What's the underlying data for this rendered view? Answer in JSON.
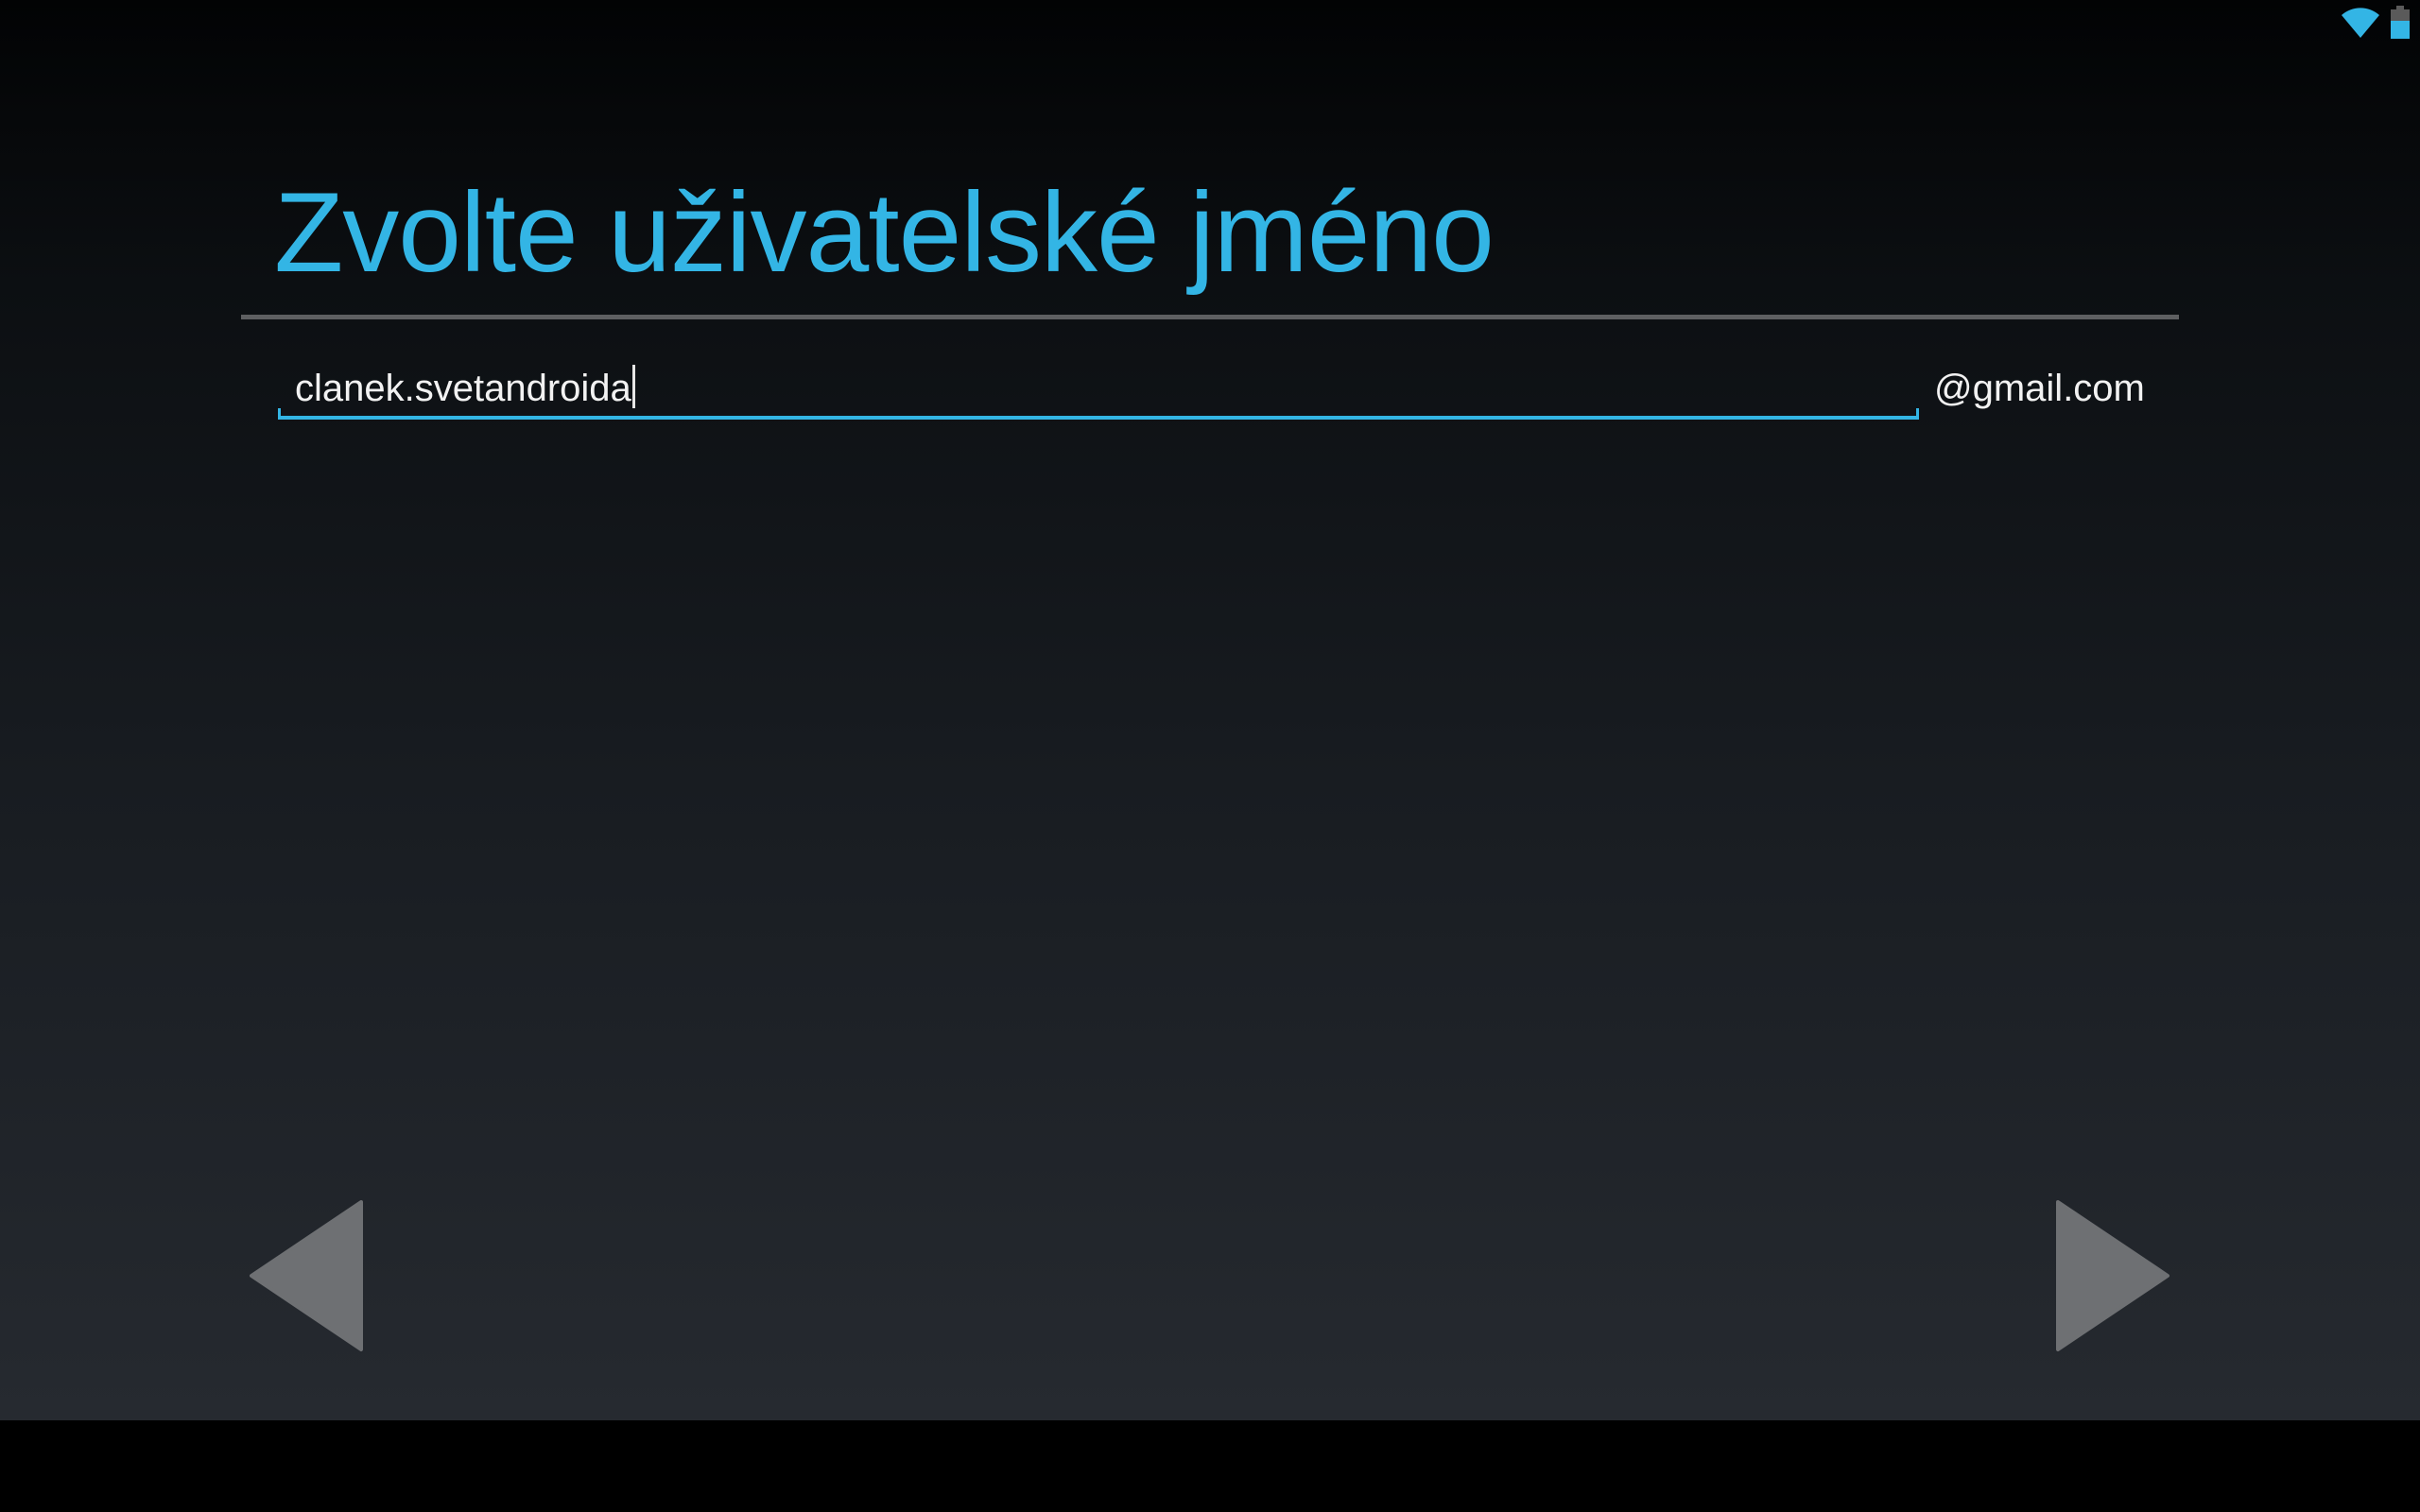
{
  "status_bar": {
    "icons": [
      "wifi-icon",
      "battery-icon"
    ],
    "accent_color": "#33b5e5"
  },
  "setup": {
    "title": "Zvolte uživatelské jméno",
    "username_value": "clanek.svetandroida",
    "domain_suffix": "@gmail.com",
    "focus_color": "#33b5e5"
  },
  "navigation": {
    "back_icon": "back-arrow-icon",
    "next_icon": "next-arrow-icon",
    "arrow_color": "#6e7073"
  }
}
